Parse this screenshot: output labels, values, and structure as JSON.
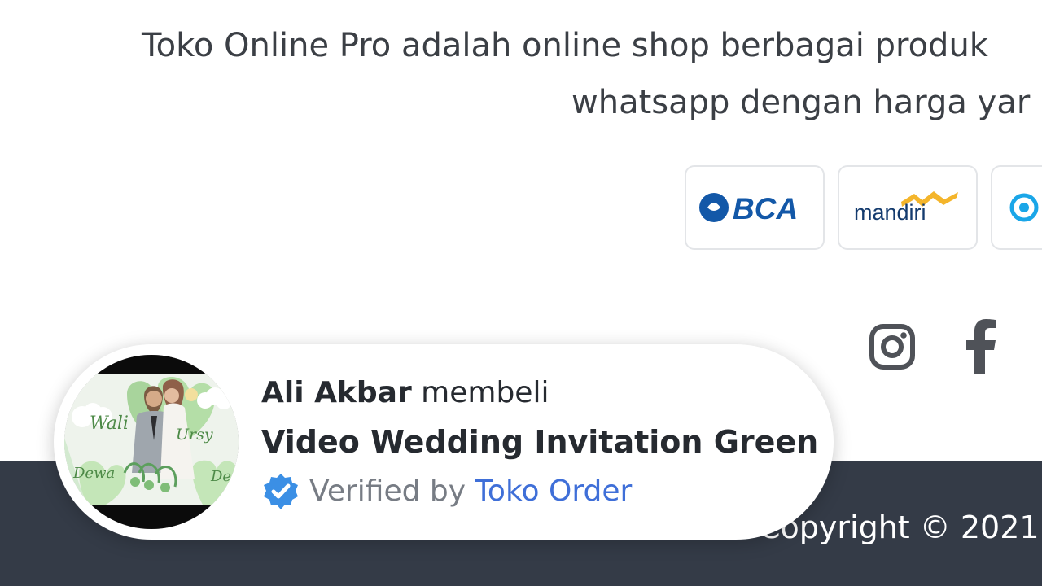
{
  "page": {
    "intro_line_1": "Toko Online Pro adalah online shop berbagai produk",
    "intro_line_2": "whatsapp dengan harga yar"
  },
  "payments": [
    {
      "name": "BCA",
      "icon": "bca-logo"
    },
    {
      "name": "mandiri",
      "icon": "mandiri-logo"
    },
    {
      "name": "",
      "icon": "bank-logo-partial"
    }
  ],
  "social": [
    {
      "icon": "instagram-icon"
    },
    {
      "icon": "facebook-icon"
    }
  ],
  "footer": {
    "copyright": "Copyright © 2021"
  },
  "notification": {
    "buyer_name": "Ali Akbar",
    "action": "membeli",
    "product": "Video Wedding Invitation Green",
    "verified_prefix": "Verified by",
    "verified_store": "Toko Order",
    "image_names": [
      "Wali",
      "Ursy",
      "Dewa",
      "De"
    ],
    "colors": {
      "accent": "#3f6fd8",
      "verified_badge": "#3b8fe5",
      "footer": "#343b47"
    }
  }
}
